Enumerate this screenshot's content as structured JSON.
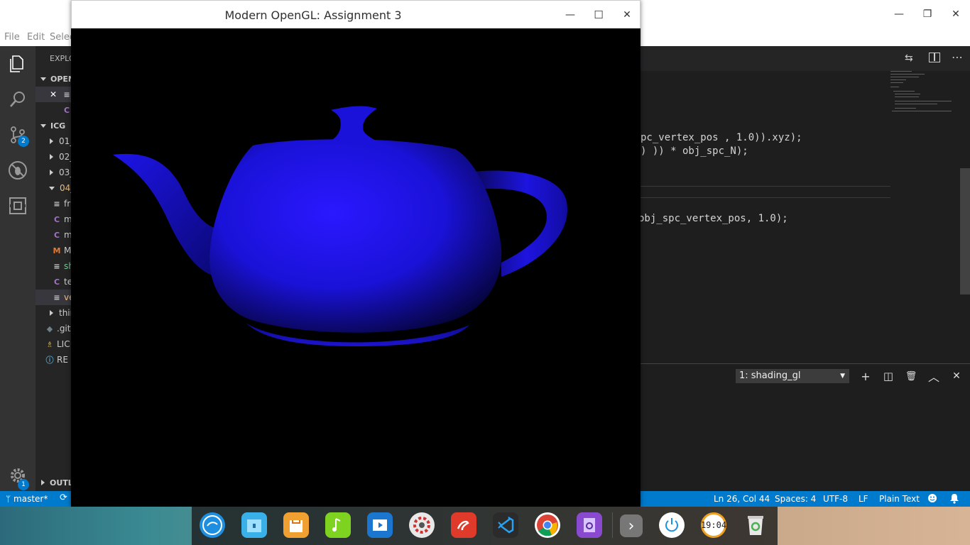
{
  "vscode": {
    "menu": {
      "file": "File",
      "edit": "Edit",
      "selection": "Selec"
    },
    "window_controls": {
      "minimize": "—",
      "restore": "❐",
      "close": "✕"
    },
    "activity_badges": {
      "scm": "2",
      "settings": "1"
    },
    "sidebar": {
      "explorer_title": "EXPLO",
      "open_editors_header": "OPEN",
      "open_editors": [
        {
          "icon": "≡",
          "label": ""
        },
        {
          "icon": "C",
          "label": ""
        }
      ],
      "folder_header": "ICG",
      "tree": [
        {
          "label": "01_",
          "icon": "",
          "color": "#cccccc"
        },
        {
          "label": "02_",
          "icon": "",
          "color": "#cccccc"
        },
        {
          "label": "03_",
          "icon": "",
          "color": "#cccccc"
        },
        {
          "label": "04_",
          "icon": "",
          "color": "#e2c08d"
        },
        {
          "label": "fr",
          "icon": "≡",
          "color": "#cccccc"
        },
        {
          "label": "m",
          "icon": "C",
          "color": "#cccccc"
        },
        {
          "label": "m",
          "icon": "C",
          "color": "#cccccc"
        },
        {
          "label": "M",
          "icon": "M",
          "color": "#cccccc"
        },
        {
          "label": "sh",
          "icon": "≡",
          "color": "#73c991"
        },
        {
          "label": "te",
          "icon": "C",
          "color": "#cccccc"
        },
        {
          "label": "ve",
          "icon": "≡",
          "color": "#e2c08d"
        },
        {
          "label": "thir",
          "icon": "",
          "color": "#cccccc"
        },
        {
          "label": ".git",
          "icon": "◆",
          "color": "#cccccc"
        },
        {
          "label": "LIC",
          "icon": "♗",
          "color": "#cccccc"
        },
        {
          "label": "RE",
          "icon": "ⓘ",
          "color": "#cccccc"
        }
      ],
      "outline_header": "OUTL"
    },
    "code": [
      "pc_vertex_pos , 1.0)).xyz);",
      ") )) * obj_spc_N);",
      "obj_spc_vertex_pos, 1.0);"
    ],
    "terminal": {
      "selected": "1: shading_gl",
      "add": "+",
      "split": "◫",
      "kill": "🗑",
      "maximize": "︿",
      "close": "✕"
    },
    "status": {
      "branch": "master*",
      "position": "Ln 26, Col 44",
      "spaces": "Spaces: 4",
      "encoding": "UTF-8",
      "eol": "LF",
      "language": "Plain Text"
    }
  },
  "opengl_window": {
    "title": "Modern OpenGL: Assignment 3",
    "controls": {
      "minimize": "—",
      "maximize": "☐",
      "close": "✕"
    },
    "teapot_color": "#1a12d8"
  },
  "dock": {
    "clock_text": "19:04",
    "arrow": "›"
  }
}
